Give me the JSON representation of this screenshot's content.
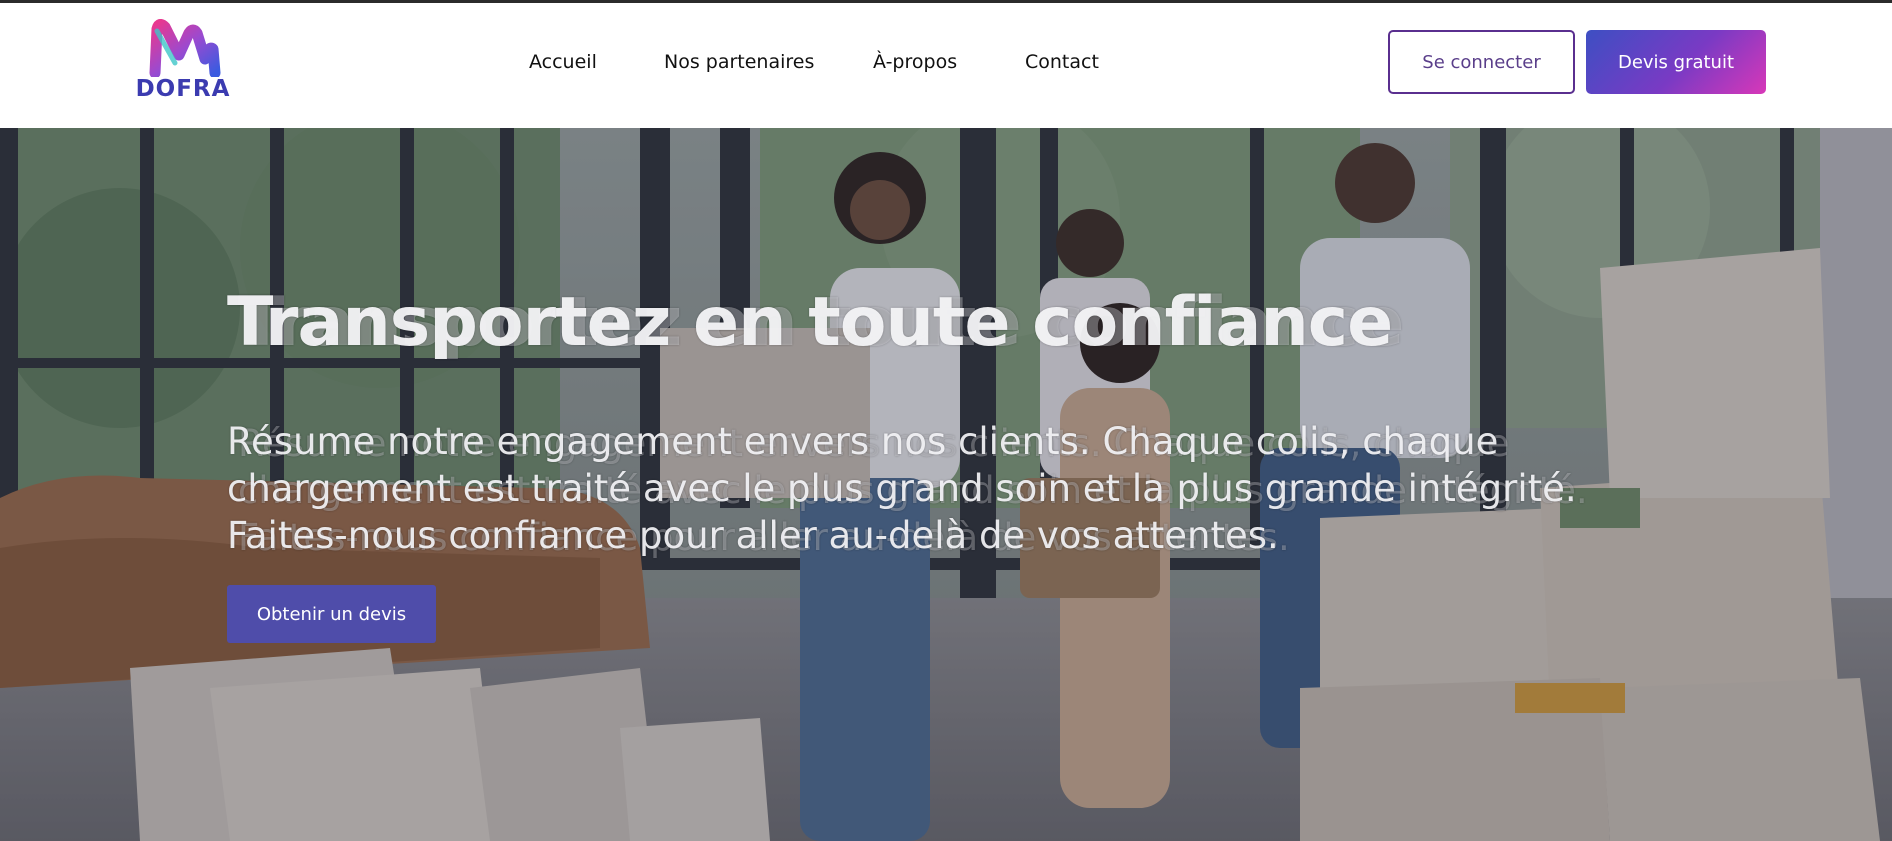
{
  "brand": {
    "name": "DOFRA"
  },
  "nav": {
    "items": [
      {
        "label": "Accueil"
      },
      {
        "label": "Nos partenaires"
      },
      {
        "label": "À-propos"
      },
      {
        "label": "Contact"
      }
    ]
  },
  "actions": {
    "login_label": "Se connecter",
    "quote_label": "Devis gratuit"
  },
  "hero": {
    "title": "Transportez en toute confiance",
    "text": "Résume notre engagement envers nos clients. Chaque colis, chaque chargement est traité avec le plus grand soin et la plus grande intégrité. Faites-nous confiance pour aller au-delà de vos attentes.",
    "cta_label": "Obtenir un devis"
  },
  "colors": {
    "accent_blue": "#3d4fc3",
    "accent_purple": "#7a3ac4",
    "accent_pink": "#d838b8",
    "login_border": "#5a2f8f"
  }
}
